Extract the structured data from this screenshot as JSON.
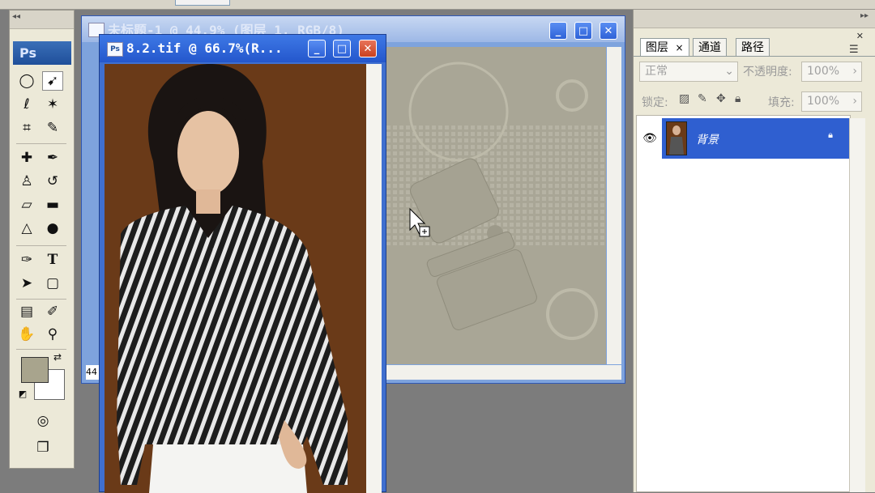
{
  "options_bar": {},
  "tools_palette": {
    "collapse_glyph": "◂◂",
    "logo_text": "Ps",
    "foreground_color": "#a8a48d",
    "background_color": "#ffffff"
  },
  "document_back": {
    "title": "未标题-1 @ 44.9% (图层 1, RGB/8)",
    "zoom_label": "44"
  },
  "document_front": {
    "title": "8.2.tif @ 66.7%(R...",
    "icon_text": "Ps"
  },
  "window_buttons": {
    "minimize": "_",
    "maximize": "□",
    "close": "✕"
  },
  "layers_palette": {
    "expand_glyph": "▸▸",
    "close_glyph": "✕",
    "tabs": [
      {
        "label": "图层",
        "close": "×"
      },
      {
        "label": "通道"
      },
      {
        "label": "路径"
      }
    ],
    "blend_mode": "正常",
    "opacity_label": "不透明度:",
    "opacity_value": "100%",
    "lock_label": "锁定:",
    "fill_label": "填充:",
    "fill_value": "100%",
    "layers": [
      {
        "name": "背景",
        "locked": true,
        "visible": true
      }
    ]
  },
  "colors": {
    "selection_blue": "#2f5fd0",
    "photo_background": "#6a3a18",
    "canvas_gray": "#a9a696"
  }
}
